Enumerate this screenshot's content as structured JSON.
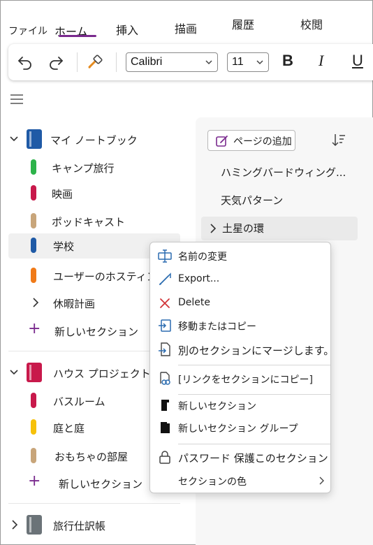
{
  "tabs": [
    {
      "label": "ファイル"
    },
    {
      "label": "ホーム"
    },
    {
      "label": "挿入"
    },
    {
      "label": "描画"
    },
    {
      "label": "履歴"
    },
    {
      "label": "校閲"
    }
  ],
  "ribbon": {
    "font_name": "Calibri",
    "font_size": "11",
    "bold": "B",
    "italic": "I",
    "underline": "U"
  },
  "notebooks": [
    {
      "name": "マイ ノートブック",
      "color": "#1f5aa6",
      "sections": [
        {
          "name": "キャンプ旅行",
          "color": "#2db34a"
        },
        {
          "name": "映画",
          "color": "#c8194b"
        },
        {
          "name": "ポッドキャスト",
          "color": "#c8a57a"
        },
        {
          "name": "学校",
          "color": "#1f5aa6",
          "selected": true
        },
        {
          "name": "ユーザーのホスティング",
          "color": "#f07a18"
        },
        {
          "name": "休暇計画"
        }
      ],
      "new_section": "新しいセクション"
    },
    {
      "name": "ハウス プロジェクト",
      "color": "#c8194b",
      "sections": [
        {
          "name": "バスルーム",
          "color": "#c8194b"
        },
        {
          "name": "庭と庭",
          "color": "#f6c10a"
        },
        {
          "name": "おもちゃの部屋",
          "color": "#c8a57a"
        }
      ],
      "new_section": "新しいセクション"
    },
    {
      "name": "旅行仕訳帳",
      "color": "#6b7378"
    }
  ],
  "pages": {
    "add_page_label": "ページの追加",
    "items": [
      {
        "title": "ハミングバードウィング..."
      },
      {
        "title": "天気パターン"
      },
      {
        "title": "土星の環"
      }
    ]
  },
  "context_menu": {
    "items": [
      {
        "label": "名前の変更",
        "icon": "rename-icon"
      },
      {
        "label": "Export...",
        "icon": "export-icon"
      },
      {
        "label": "Delete",
        "icon": "delete-icon"
      },
      {
        "label": "移動またはコピー",
        "icon": "move-copy-icon"
      },
      {
        "label": "別のセクションにマージします。",
        "icon": "merge-icon"
      },
      {
        "label": "[リンクをセクションにコピー]",
        "icon": "copy-link-icon"
      },
      {
        "label": "新しいセクション",
        "icon": "new-section-icon"
      },
      {
        "label": "新しいセクション グループ",
        "icon": "new-section-group-icon"
      },
      {
        "label": "パスワード 保護このセクション",
        "icon": "lock-icon"
      },
      {
        "label": "セクションの色",
        "icon": "chevron-right-icon"
      }
    ]
  },
  "colors": {
    "accent": "#7a2a8e",
    "delete_red": "#d13438",
    "icon_blue": "#2b6cb0"
  }
}
